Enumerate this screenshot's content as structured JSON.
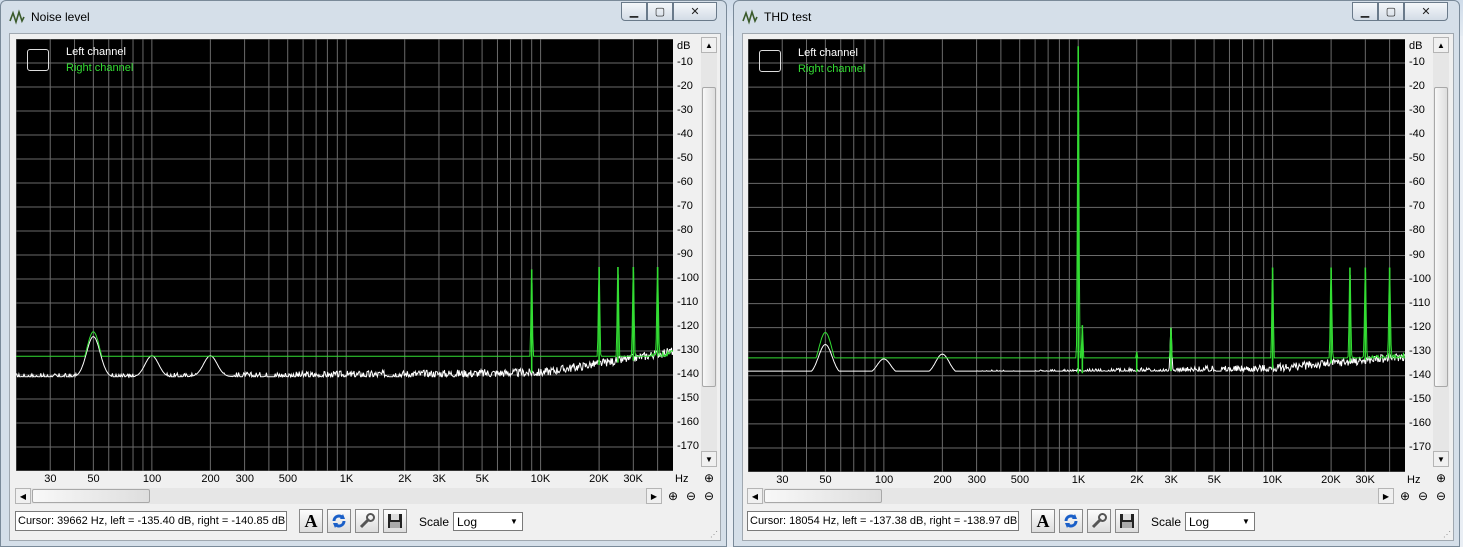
{
  "windows": [
    {
      "title": "Noise level",
      "legend": {
        "left": "Left channel",
        "right": "Right channel"
      },
      "y_unit": "dB",
      "y_labels": [
        "-10",
        "-20",
        "-30",
        "-40",
        "-50",
        "-60",
        "-70",
        "-80",
        "-90",
        "-100",
        "-110",
        "-120",
        "-130",
        "-140",
        "-150",
        "-160",
        "-170"
      ],
      "x_unit": "Hz",
      "x_labels": [
        "30",
        "50",
        "100",
        "200",
        "300",
        "500",
        "1K",
        "2K",
        "3K",
        "5K",
        "10K",
        "20K",
        "30K"
      ],
      "cursor_text": "Cursor:  39662 Hz,  left = -135.40 dB,  right = -140.85 dB",
      "scale_label": "Scale",
      "scale_value": "Log",
      "tool_font_label": "A"
    },
    {
      "title": "THD test",
      "legend": {
        "left": "Left channel",
        "right": "Right channel"
      },
      "y_unit": "dB",
      "y_labels": [
        "-10",
        "-20",
        "-30",
        "-40",
        "-50",
        "-60",
        "-70",
        "-80",
        "-90",
        "-100",
        "-110",
        "-120",
        "-130",
        "-140",
        "-150",
        "-160",
        "-170"
      ],
      "x_unit": "Hz",
      "x_labels": [
        "30",
        "50",
        "100",
        "200",
        "300",
        "500",
        "1K",
        "2K",
        "3K",
        "5K",
        "10K",
        "20K",
        "30K"
      ],
      "cursor_text": "Cursor:  18054 Hz,  left = -137.38 dB,  right = -138.97 dB",
      "scale_label": "Scale",
      "scale_value": "Log",
      "tool_font_label": "A"
    }
  ],
  "colors": {
    "left_channel": "#ffffff",
    "right_channel": "#33dd33",
    "plot_bg": "#000000",
    "grid": "#6a6a6a"
  },
  "chart_data": [
    {
      "type": "line",
      "x_scale": "log",
      "xlim": [
        20,
        48000
      ],
      "ylim": [
        -180,
        0
      ],
      "series": [
        {
          "name": "Left channel",
          "peaks": [
            [
              50,
              -124
            ],
            [
              100,
              -132
            ],
            [
              200,
              -132
            ]
          ],
          "floor": [
            [
              20,
              -141
            ],
            [
              100,
              -141
            ],
            [
              1000,
              -140
            ],
            [
              10000,
              -139
            ],
            [
              30000,
              -133
            ],
            [
              48000,
              -130
            ]
          ]
        },
        {
          "name": "Right channel",
          "peaks": [
            [
              50,
              -122
            ],
            [
              100,
              -132
            ],
            [
              9000,
              -96
            ],
            [
              20000,
              -95
            ],
            [
              25000,
              -95
            ],
            [
              30000,
              -95
            ],
            [
              40000,
              -95
            ]
          ],
          "floor": [
            [
              20,
              -140
            ],
            [
              100,
              -142
            ],
            [
              300,
              -143
            ],
            [
              1000,
              -140
            ],
            [
              10000,
              -139
            ],
            [
              30000,
              -134
            ],
            [
              48000,
              -131
            ]
          ]
        }
      ]
    },
    {
      "type": "line",
      "x_scale": "log",
      "xlim": [
        20,
        48000
      ],
      "ylim": [
        -180,
        0
      ],
      "series": [
        {
          "name": "Left channel",
          "peaks": [
            [
              50,
              -127
            ],
            [
              100,
              -133
            ],
            [
              200,
              -131
            ],
            [
              3000,
              -120
            ]
          ],
          "floor": [
            [
              20,
              -140
            ],
            [
              1000,
              -139
            ],
            [
              10000,
              -137
            ],
            [
              48000,
              -132
            ]
          ]
        },
        {
          "name": "Right channel",
          "peaks": [
            [
              50,
              -122
            ],
            [
              100,
              -133
            ],
            [
              1000,
              -3
            ],
            [
              1050,
              -119
            ],
            [
              2000,
              -130
            ],
            [
              3000,
              -120
            ],
            [
              10000,
              -95
            ],
            [
              20000,
              -95
            ],
            [
              25000,
              -95
            ],
            [
              30000,
              -95
            ],
            [
              40000,
              -95
            ]
          ],
          "floor": [
            [
              20,
              -140
            ],
            [
              1000,
              -139
            ],
            [
              10000,
              -137
            ],
            [
              48000,
              -132
            ]
          ]
        }
      ]
    }
  ]
}
